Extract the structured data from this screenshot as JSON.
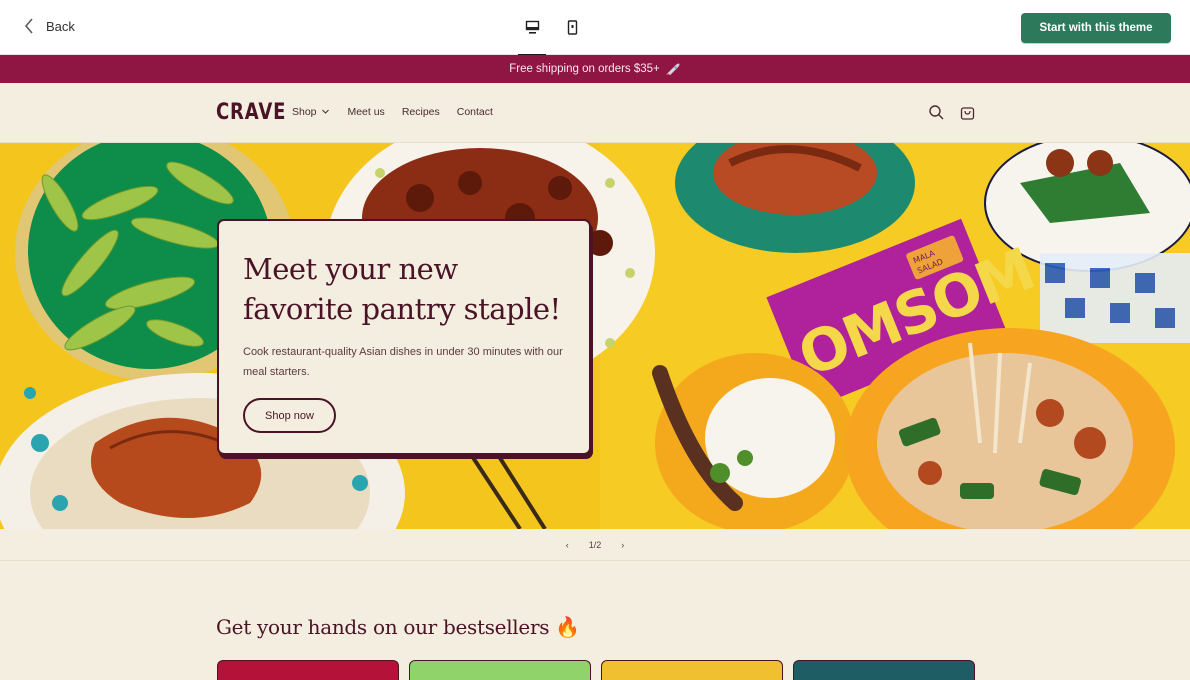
{
  "preview_bar": {
    "back_label": "Back",
    "devices": [
      "desktop-icon",
      "mobile-icon"
    ],
    "active_device": "desktop",
    "cta_label": "Start with this theme",
    "cta_color": "#2c7a5b"
  },
  "announcement": {
    "text": "Free shipping on orders $35+",
    "icon": "rocket-icon",
    "bg_color": "#8f1542"
  },
  "header": {
    "logo": "CRAVE",
    "nav": [
      "Shop",
      "Meet us",
      "Recipes",
      "Contact"
    ],
    "icons": [
      "search-icon",
      "cart-icon"
    ]
  },
  "hero": {
    "title": "Meet your new favorite pantry staple!",
    "subtitle": "Cook restaurant-quality Asian dishes in under 30 minutes with our meal starters.",
    "button_label": "Shop now",
    "package_text": "OMSOM",
    "package_tag": "MALA SALAD"
  },
  "slider": {
    "prev": "‹",
    "counter": "1/2",
    "next": "›"
  },
  "bestsellers": {
    "title": "Get your hands on our bestsellers 🔥",
    "card_colors": [
      "#b5123a",
      "#8fd36a",
      "#f0c030",
      "#1d5d63"
    ]
  },
  "colors": {
    "brand": "#4a1327",
    "background": "#f3eedf",
    "hero_bg": "#f2c526"
  }
}
